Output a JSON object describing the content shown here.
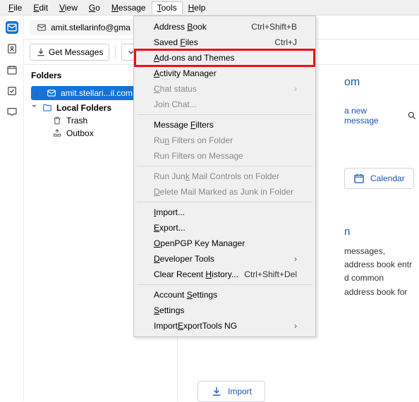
{
  "menubar": [
    "File",
    "Edit",
    "View",
    "Go",
    "Message",
    "Tools",
    "Help"
  ],
  "menubar_open_index": 5,
  "tab": {
    "label": "amit.stellarinfo@gma"
  },
  "toolbar": {
    "get_messages": "Get Messages"
  },
  "folders": {
    "header": "Folders",
    "account": "amit.stellari...il.com",
    "local": "Local Folders",
    "trash": "Trash",
    "outbox": "Outbox"
  },
  "main": {
    "account_suffix": "om",
    "write_link": "a new message",
    "search_label": "Se",
    "calendar": "Calendar",
    "setup_heading_suffix": "n",
    "desc1": "messages, address book entr",
    "desc2": "d common address book for",
    "import": "Import"
  },
  "tools_menu": [
    {
      "label": "Address Book",
      "u": 8,
      "shortcut": "Ctrl+Shift+B"
    },
    {
      "label": "Saved Files",
      "u": 6,
      "shortcut": "Ctrl+J"
    },
    {
      "label": "Add-ons and Themes",
      "u": 0,
      "highlight": true
    },
    {
      "label": "Activity Manager",
      "u": 0
    },
    {
      "label": "Chat status",
      "u": 0,
      "disabled": true,
      "submenu": true
    },
    {
      "label": "Join Chat...",
      "disabled": true
    },
    {
      "sep": true
    },
    {
      "label": "Message Filters",
      "u": 8
    },
    {
      "label": "Run Filters on Folder",
      "u": 2,
      "disabled": true
    },
    {
      "label": "Run Filters on Message",
      "disabled": true
    },
    {
      "sep": true
    },
    {
      "label": "Run Junk Mail Controls on Folder",
      "u": 7,
      "disabled": true
    },
    {
      "label": "Delete Mail Marked as Junk in Folder",
      "u": 0,
      "disabled": true
    },
    {
      "sep": true
    },
    {
      "label": "Import...",
      "u": 0
    },
    {
      "label": "Export...",
      "u": 0
    },
    {
      "label": "OpenPGP Key Manager",
      "u": 0
    },
    {
      "label": "Developer Tools",
      "u": 0,
      "submenu": true
    },
    {
      "label": "Clear Recent History...",
      "u": 13,
      "shortcut": "Ctrl+Shift+Del"
    },
    {
      "sep": true
    },
    {
      "label": "Account Settings",
      "u": 8
    },
    {
      "label": "Settings",
      "u": 0
    },
    {
      "label": "ImportExportTools NG",
      "u": 6,
      "submenu": true
    }
  ]
}
